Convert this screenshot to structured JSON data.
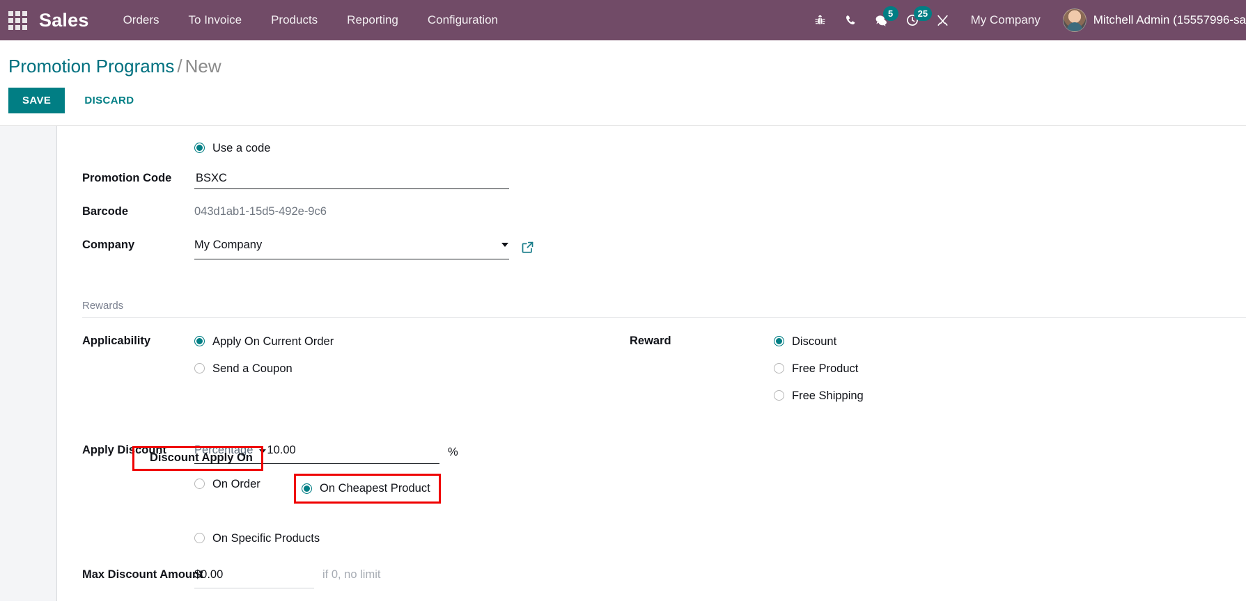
{
  "navbar": {
    "apps_icon": "apps-grid-icon",
    "brand": "Sales",
    "menu": [
      {
        "label": "Orders"
      },
      {
        "label": "To Invoice"
      },
      {
        "label": "Products"
      },
      {
        "label": "Reporting"
      },
      {
        "label": "Configuration"
      }
    ],
    "icons": [
      {
        "name": "bug-icon",
        "badge": null
      },
      {
        "name": "phone-icon",
        "badge": null
      },
      {
        "name": "messages-icon",
        "badge": "5"
      },
      {
        "name": "activities-clock-icon",
        "badge": "25"
      },
      {
        "name": "tools-wrench-icon",
        "badge": null
      }
    ],
    "company": "My Company",
    "user": "Mitchell Admin (15557996-sa",
    "bg_color": "#714B67",
    "badge_color": "#017E84"
  },
  "control_panel": {
    "breadcrumb_root": "Promotion Programs",
    "breadcrumb_separator": "/",
    "breadcrumb_current": "New",
    "save_label": "SAVE",
    "discard_label": "DISCARD",
    "accent_color": "#017E84"
  },
  "form": {
    "code_mode": {
      "label": "Use a code",
      "selected": true
    },
    "promotion_code": {
      "label": "Promotion Code",
      "value": "BSXC"
    },
    "barcode": {
      "label": "Barcode",
      "value": "043d1ab1-15d5-492e-9c6"
    },
    "company": {
      "label": "Company",
      "value": "My Company",
      "dropdown_icon": "chevron-down-icon",
      "external_link_icon": "external-link-icon"
    },
    "rewards_section": {
      "title": "Rewards"
    },
    "applicability": {
      "label": "Applicability",
      "options": [
        {
          "label": "Apply On Current Order",
          "selected": true
        },
        {
          "label": "Send a Coupon",
          "selected": false
        }
      ]
    },
    "reward": {
      "label": "Reward",
      "options": [
        {
          "label": "Discount",
          "selected": true
        },
        {
          "label": "Free Product",
          "selected": false
        },
        {
          "label": "Free Shipping",
          "selected": false
        }
      ]
    },
    "apply_discount": {
      "label": "Apply Discount",
      "type": "Percentage",
      "value": "10.00",
      "suffix": "%"
    },
    "discount_apply_on": {
      "label": "Discount Apply On",
      "options": [
        {
          "label": "On Order",
          "selected": false
        },
        {
          "label": "On Cheapest Product",
          "selected": true
        },
        {
          "label": "On Specific Products",
          "selected": false
        }
      ]
    },
    "max_discount_amount": {
      "label": "Max Discount Amount",
      "value": "$0.00",
      "placeholder": "if 0, no limit"
    }
  },
  "annotations": {
    "highlight_color": "#ef0000",
    "boxes": [
      {
        "target": "discount-apply-on-label"
      },
      {
        "target": "on-cheapest-product-radio"
      }
    ]
  }
}
